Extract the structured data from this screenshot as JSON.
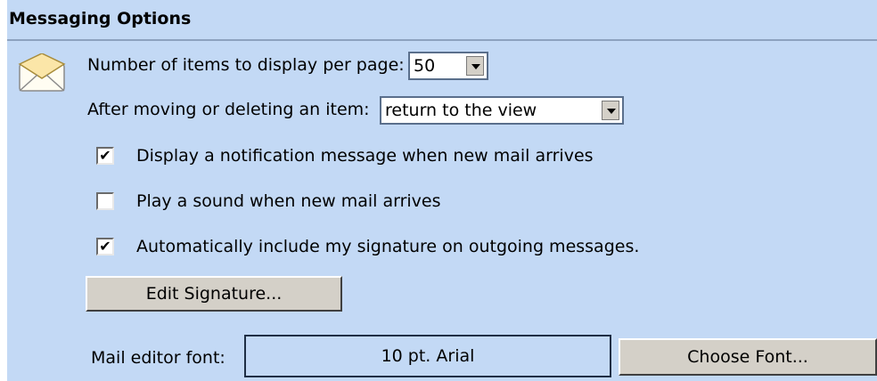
{
  "section": {
    "title": "Messaging Options",
    "icon": "envelope-icon"
  },
  "items_per_page": {
    "label": "Number of items to display per page:",
    "value": "50"
  },
  "after_move": {
    "label": "After moving or deleting an item:",
    "value": "return to the view"
  },
  "checkboxes": [
    {
      "label": "Display a notification message when new mail arrives",
      "checked": true
    },
    {
      "label": "Play a sound when new mail arrives",
      "checked": false
    },
    {
      "label": "Automatically include my signature on outgoing messages.",
      "checked": true
    }
  ],
  "edit_signature_button": "Edit Signature...",
  "mail_editor_font": {
    "label": "Mail editor font:",
    "value": "10 pt. Arial"
  },
  "choose_font_button": "Choose Font...",
  "colors": {
    "panel_bg": "#c3d9f5",
    "button_bg": "#d4d0c8"
  }
}
